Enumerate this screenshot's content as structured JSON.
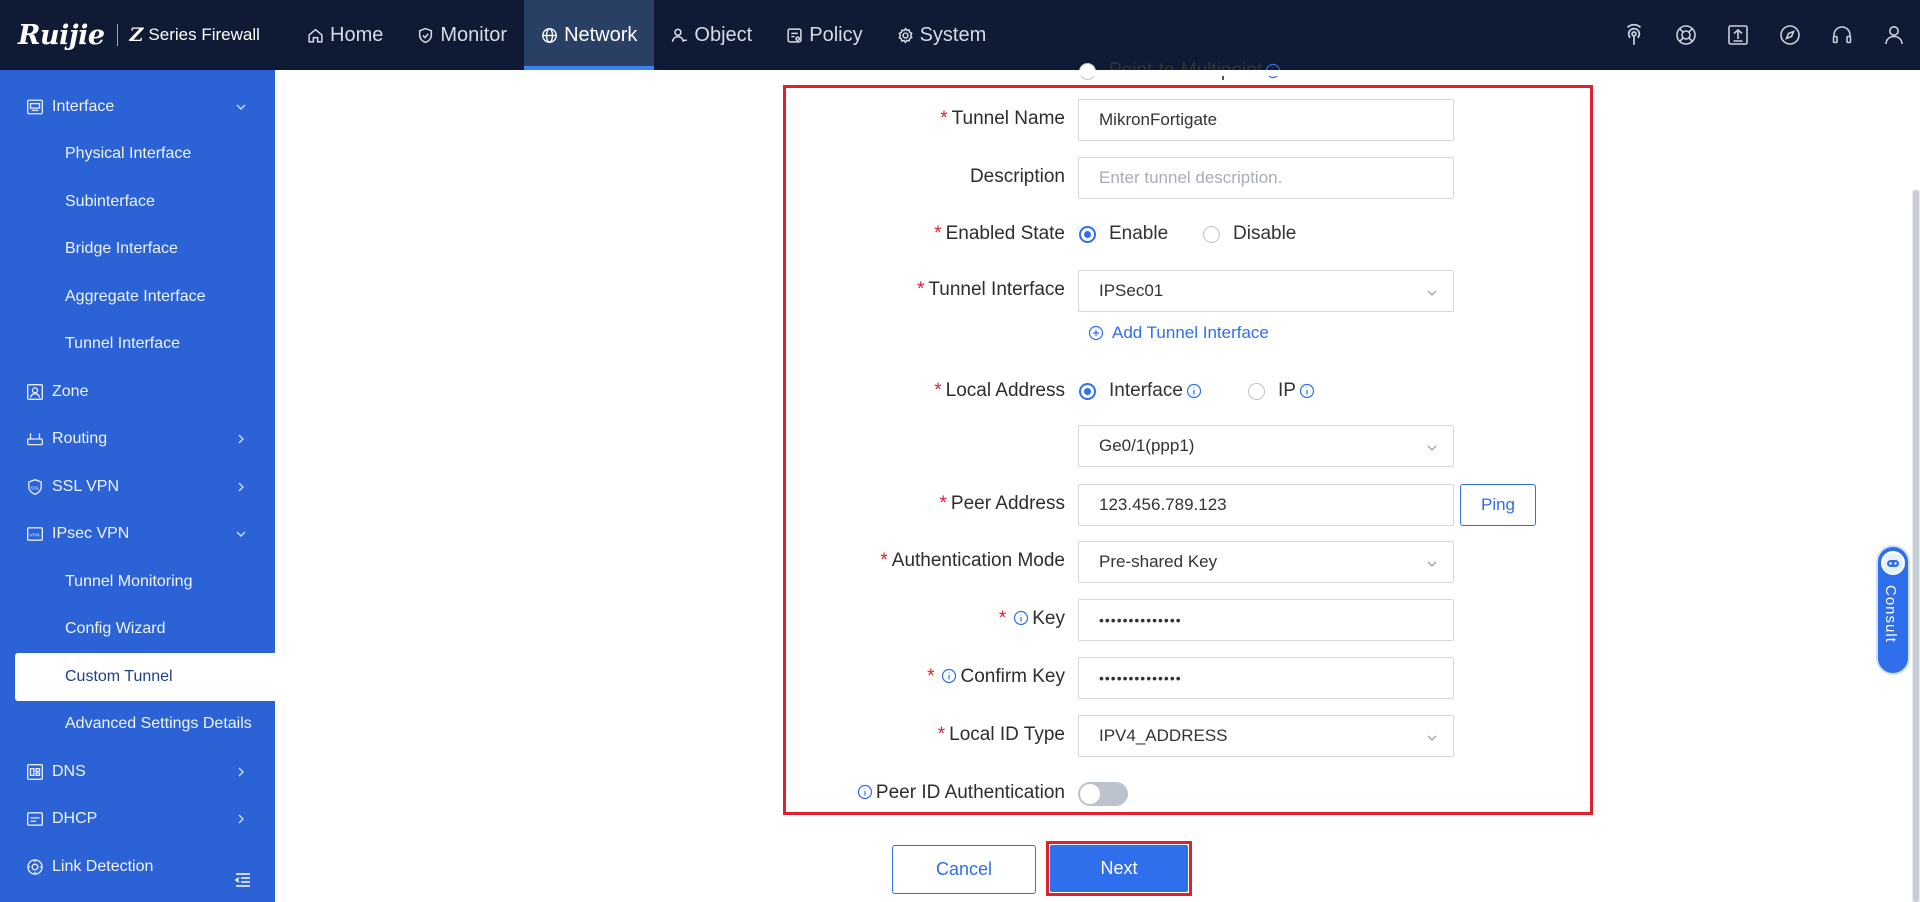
{
  "brand": {
    "logo": "Ruijie",
    "product": "Series Firewall"
  },
  "nav": [
    {
      "label": "Home",
      "icon": "home-icon"
    },
    {
      "label": "Monitor",
      "icon": "shield-icon"
    },
    {
      "label": "Network",
      "icon": "globe-icon"
    },
    {
      "label": "Object",
      "icon": "user-object-icon"
    },
    {
      "label": "Policy",
      "icon": "policy-icon"
    },
    {
      "label": "System",
      "icon": "gear-icon"
    }
  ],
  "active_nav": "Network",
  "top_icons": [
    "wireless-icon",
    "support-icon",
    "upload-icon",
    "compass-icon",
    "headset-icon",
    "user-icon"
  ],
  "sidebar": {
    "interface": {
      "label": "Interface",
      "children": [
        "Physical Interface",
        "Subinterface",
        "Bridge Interface",
        "Aggregate Interface",
        "Tunnel Interface"
      ]
    },
    "zone": {
      "label": "Zone"
    },
    "routing": {
      "label": "Routing"
    },
    "ssl_vpn": {
      "label": "SSL VPN"
    },
    "ipsec_vpn": {
      "label": "IPsec VPN",
      "children": [
        "Tunnel Monitoring",
        "Config Wizard",
        "Custom Tunnel",
        "Advanced Settings Details"
      ]
    },
    "dns": {
      "label": "DNS"
    },
    "dhcp": {
      "label": "DHCP"
    },
    "link_detection": {
      "label": "Link Detection"
    },
    "selected": "Custom Tunnel"
  },
  "form": {
    "partial_option": "Point-to-Multipoint",
    "tunnel_name": {
      "label": "Tunnel Name",
      "value": "MikronFortigate"
    },
    "description": {
      "label": "Description",
      "placeholder": "Enter tunnel description."
    },
    "enabled_state": {
      "label": "Enabled State",
      "options": [
        "Enable",
        "Disable"
      ],
      "selected": "Enable"
    },
    "tunnel_interface": {
      "label": "Tunnel Interface",
      "value": "IPSec01",
      "add_link": "Add Tunnel Interface"
    },
    "local_address": {
      "label": "Local Address",
      "options": [
        "Interface",
        "IP"
      ],
      "selected": "Interface",
      "interface_value": "Ge0/1(ppp1)"
    },
    "peer_address": {
      "label": "Peer Address",
      "value": "123.456.789.123",
      "ping": "Ping"
    },
    "auth_mode": {
      "label": "Authentication Mode",
      "value": "Pre-shared Key"
    },
    "key": {
      "label": "Key",
      "value": "••••••••••••••"
    },
    "confirm_key": {
      "label": "Confirm Key",
      "value": "••••••••••••••"
    },
    "local_id_type": {
      "label": "Local ID Type",
      "value": "IPV4_ADDRESS"
    },
    "peer_id_auth": {
      "label": "Peer ID Authentication",
      "enabled": false
    }
  },
  "buttons": {
    "cancel": "Cancel",
    "next": "Next"
  },
  "consult": "Consult",
  "colors": {
    "topbar": "#0f1b34",
    "sidebar": "#2b63d6",
    "accent": "#2f6fec",
    "highlight": "#e0202e"
  }
}
